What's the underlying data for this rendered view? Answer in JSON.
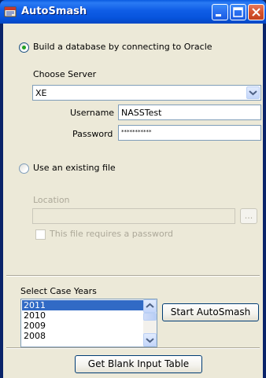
{
  "window": {
    "title": "AutoSmash",
    "icon": "app-icon",
    "controls": [
      "minimize-icon",
      "maximize-icon",
      "close-icon"
    ]
  },
  "oracle": {
    "radio_label": "Build a database by connecting to Oracle",
    "selected": true,
    "choose_server_label": "Choose Server",
    "server_value": "XE",
    "username_label": "Username",
    "username_value": "NASSTest",
    "password_label": "Password",
    "password_value": "***********"
  },
  "file": {
    "radio_label": "Use an existing file",
    "selected": false,
    "location_label": "Location",
    "location_value": "",
    "browse_label": "...",
    "requires_password_label": "This file requires a password",
    "requires_password_checked": false
  },
  "case_years": {
    "label": "Select Case Years",
    "items": [
      "2011",
      "2010",
      "2009",
      "2008"
    ],
    "selected": "2011"
  },
  "buttons": {
    "start": "Start AutoSmash",
    "blank_table": "Get Blank Input Table"
  },
  "colors": {
    "titlebar": "#0754dd",
    "client": "#ece9d8",
    "selection": "#316ac5",
    "radio_dot": "#21a121",
    "close_button": "#d5522e"
  }
}
